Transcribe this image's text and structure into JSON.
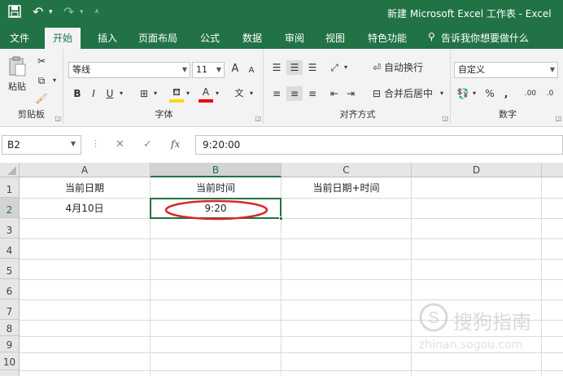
{
  "titlebar": {
    "title": "新建 Microsoft Excel 工作表 - Excel"
  },
  "tabs": [
    "文件",
    "开始",
    "插入",
    "页面布局",
    "公式",
    "数据",
    "审阅",
    "视图",
    "特色功能"
  ],
  "tell_me": "告诉我你想要做什么",
  "clipboard": {
    "paste": "粘贴",
    "group": "剪贴板"
  },
  "font": {
    "name": "等线",
    "size": "11",
    "bold": "B",
    "italic": "I",
    "underline": "U",
    "grow": "A",
    "shrink": "A",
    "font_color": "A",
    "phonetic": "文",
    "group": "字体"
  },
  "align": {
    "wrap": "自动换行",
    "merge": "合并后居中",
    "group": "对齐方式"
  },
  "number": {
    "format": "自定义",
    "percent": "%",
    "comma": ",",
    "inc": ".00",
    "dec": ".0",
    "group": "数字"
  },
  "formula_bar": {
    "name_box": "B2",
    "cancel": "✕",
    "enter": "✓",
    "fx": "fx",
    "content": "9:20:00"
  },
  "columns": [
    "A",
    "B",
    "C",
    "D"
  ],
  "rows": [
    "1",
    "2",
    "3",
    "4",
    "5",
    "6",
    "7",
    "8",
    "9",
    "10"
  ],
  "cells": {
    "A1": "当前日期",
    "B1": "当前时间",
    "C1": "当前日期+时间",
    "A2": "4月10日",
    "B2": "9:20"
  },
  "watermark": {
    "text": "搜狗指南",
    "url": "zhinan.sogou.com"
  },
  "colors": {
    "brand": "#217346",
    "highlight_ellipse": "#d9262a"
  }
}
